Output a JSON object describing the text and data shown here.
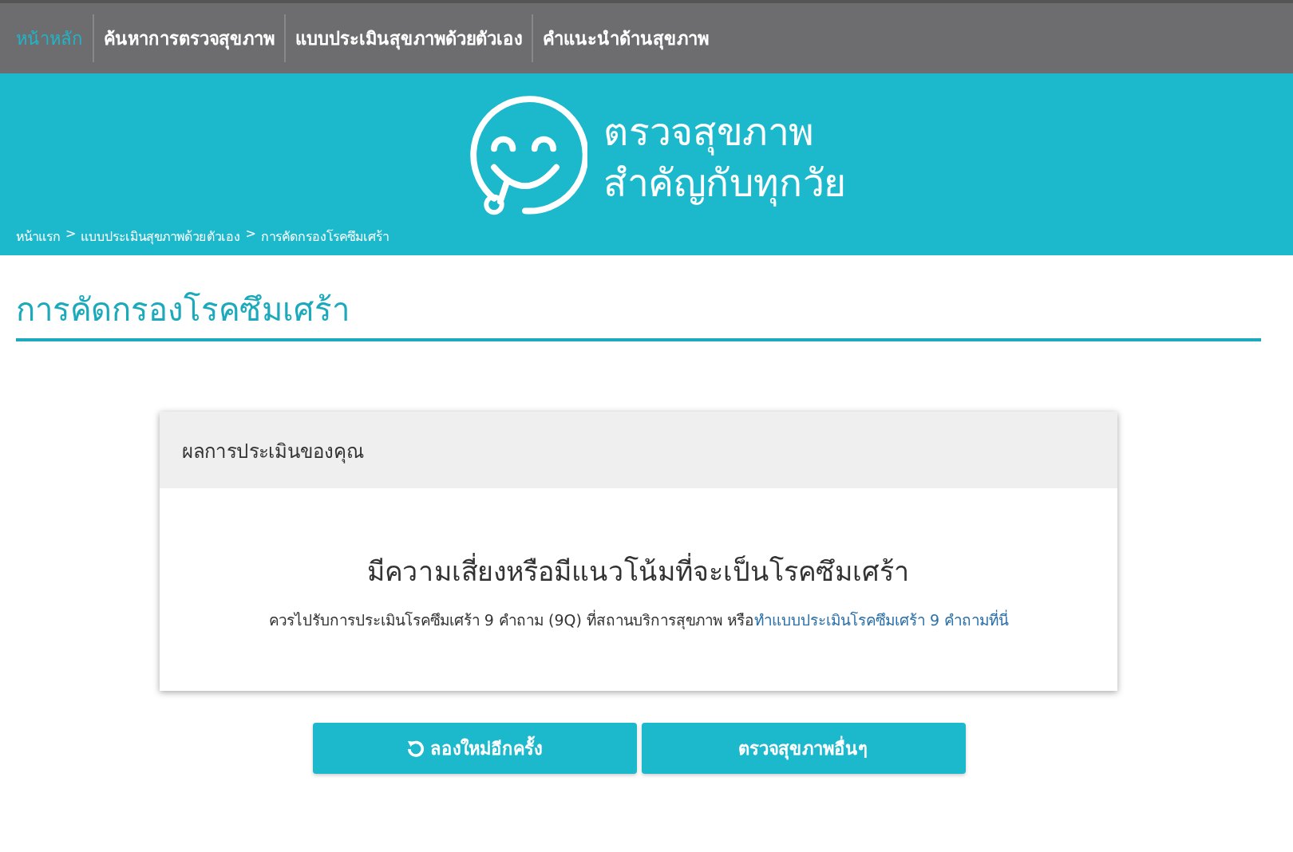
{
  "nav": [
    {
      "label": "หน้าหลัก",
      "selected": true
    },
    {
      "label": "ค้นหาการตรวจสุขภาพ",
      "selected": false
    },
    {
      "label": "แบบประเมินสุขภาพด้วยตัวเอง",
      "selected": false
    },
    {
      "label": "คำแนะนำด้านสุขภาพ",
      "selected": false
    }
  ],
  "banner": {
    "logo_line_1": "ตรวจสุขภาพ",
    "logo_line_2": "สำคัญกับทุกวัย"
  },
  "breadcrumb": [
    "หน้าแรก",
    "แบบประเมินสุขภาพด้วยตัวเอง",
    "การคัดกรองโรคซึมเศร้า"
  ],
  "breadcrumb_separator": ">",
  "page_title": "การคัดกรองโรคซึมเศร้า",
  "result_card": {
    "header": "ผลการประเมินของคุณ",
    "result": "มีความเสี่ยงหรือมีแนวโน้มที่จะเป็นโรคซึมเศร้า",
    "advice": "ควรไปรับการประเมินโรคซึมเศร้า 9 คำถาม (9Q) ที่สถานบริการสุขภาพ หรือ",
    "advice_link": "ทำแบบประเมินโรคซึมเศร้า 9 คำถามที่นี่"
  },
  "buttons": [
    {
      "label": "ลองใหม่อีกครั้ง",
      "kind": "retry"
    },
    {
      "label": "ตรวจสุขภาพอื่นๆ",
      "kind": "plain"
    }
  ]
}
